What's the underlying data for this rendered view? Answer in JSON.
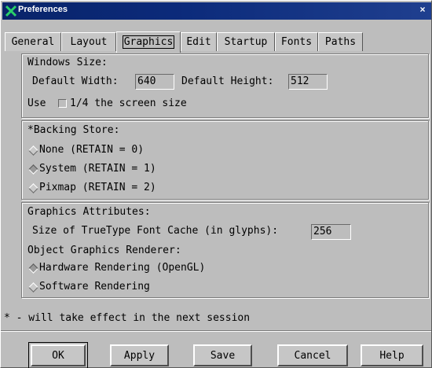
{
  "window": {
    "title": "Preferences",
    "close_glyph": "×"
  },
  "tabs": [
    {
      "label": "General"
    },
    {
      "label": "Layout"
    },
    {
      "label": "Graphics",
      "active": true
    },
    {
      "label": "Edit"
    },
    {
      "label": "Startup"
    },
    {
      "label": "Fonts"
    },
    {
      "label": "Paths"
    }
  ],
  "windows_size": {
    "heading": "Windows Size:",
    "width_label": "Default Width:",
    "width_value": "640",
    "height_label": "Default Height:",
    "height_value": "512",
    "quarter_prefix": "Use",
    "quarter_label": "1/4 the screen size",
    "quarter_checked": false
  },
  "backing_store": {
    "heading": "*Backing Store:",
    "options": [
      {
        "label": "None (RETAIN = 0)",
        "selected": false
      },
      {
        "label": "System (RETAIN = 1)",
        "selected": true
      },
      {
        "label": "Pixmap (RETAIN = 2)",
        "selected": false
      }
    ]
  },
  "graphics_attributes": {
    "heading": "Graphics Attributes:",
    "font_cache_label": "Size of TrueType Font Cache (in glyphs):",
    "font_cache_value": "256",
    "renderer_heading": "Object Graphics Renderer:",
    "renderer_options": [
      {
        "label": "Hardware Rendering (OpenGL)",
        "selected": true
      },
      {
        "label": "Software Rendering",
        "selected": false
      }
    ]
  },
  "note": "* - will take effect in the next session",
  "buttons": {
    "ok": "OK",
    "apply": "Apply",
    "save": "Save",
    "cancel": "Cancel",
    "help": "Help"
  }
}
